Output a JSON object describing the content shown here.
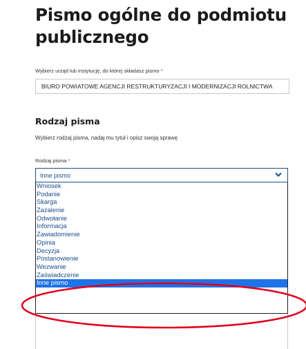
{
  "page": {
    "title": "Pismo ogólne do podmiotu publicznego"
  },
  "institution": {
    "label": "Wybierz urząd lub instytucję, do której składasz pismo",
    "required_mark": "*",
    "value": "BIURO POWIATOWE AGENCJI RESTRUKTURYZACJI I MODERNIZACJI ROLNICTWA"
  },
  "section": {
    "title": "Rodzaj pisma",
    "description": "Wybierz rodzaj pisma, nadaj mu tytuł i opisz swoją sprawę"
  },
  "letter_type": {
    "label": "Rodzaj pisma",
    "required_mark": "*",
    "selected": "Inne pismo",
    "chevron_icon": "chevron-down-icon",
    "options": [
      "Wniosek",
      "Podanie",
      "Skarga",
      "Zażalenie",
      "Odwołanie",
      "Informacja",
      "Zawiadomienie",
      "Opinia",
      "Decyzja",
      "Postanowienie",
      "Wezwanie",
      "Zaświadczenie",
      "Inne pismo"
    ],
    "highlighted_option": "Inne pismo"
  },
  "colors": {
    "accent": "#1a4d8c",
    "selected_bg": "#1e73e8",
    "required": "#d4351c",
    "annotation": "#e0001b"
  }
}
